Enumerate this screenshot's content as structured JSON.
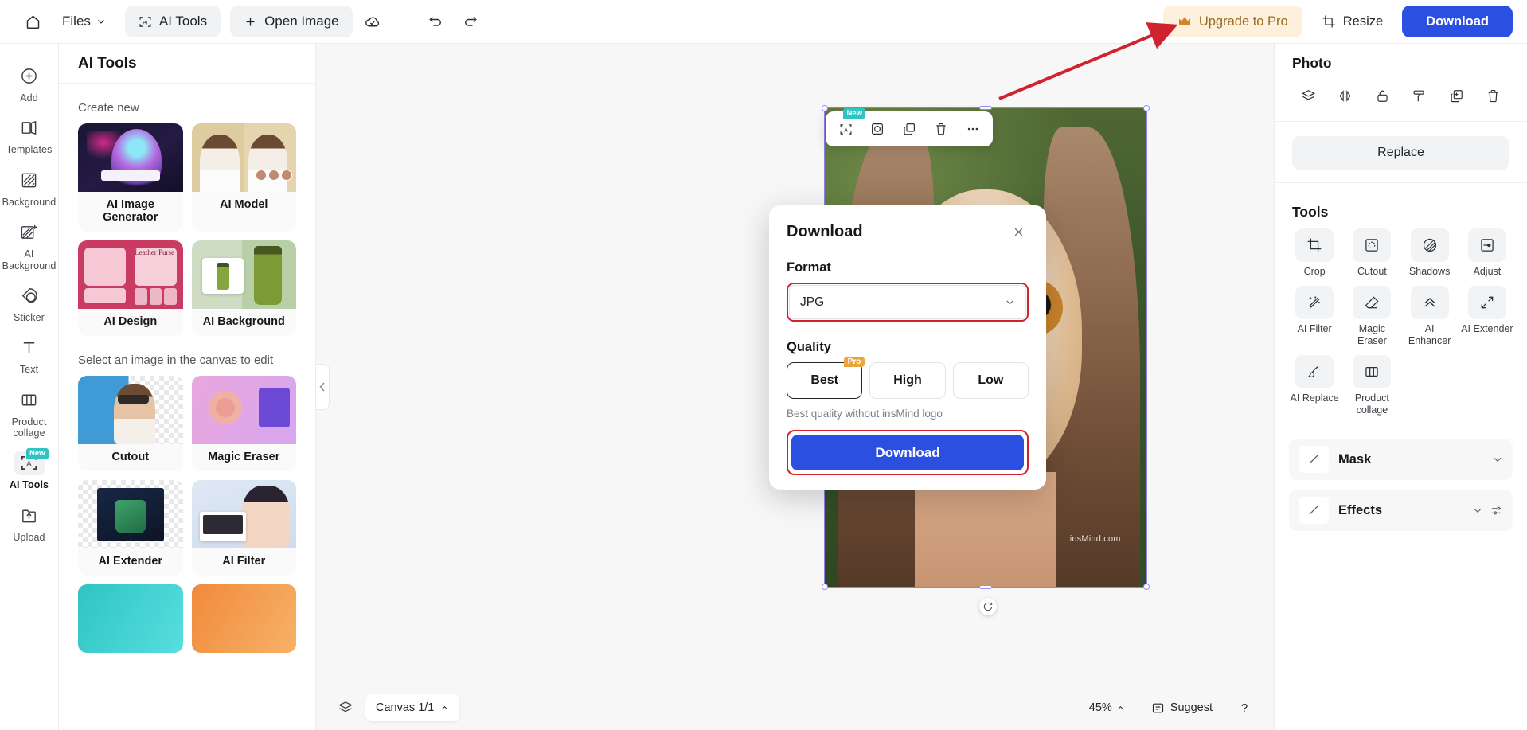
{
  "topbar": {
    "home_icon": "home-icon",
    "files_label": "Files",
    "ai_tools_label": "AI Tools",
    "open_image_label": "Open Image",
    "cloud_icon": "cloud-check-icon",
    "undo_icon": "undo-icon",
    "redo_icon": "redo-icon",
    "upgrade_label": "Upgrade to Pro",
    "crown_icon": "crown-icon",
    "resize_label": "Resize",
    "resize_icon": "crop-icon",
    "download_label": "Download",
    "accent_blue": "#2b4fe0",
    "upgrade_bg": "#fdf0dd",
    "upgrade_text": "#9a6a22"
  },
  "rail": {
    "items": [
      {
        "label": "Add",
        "icon": "plus-circle-icon",
        "active": false
      },
      {
        "label": "Templates",
        "icon": "templates-icon",
        "active": false
      },
      {
        "label": "Background",
        "icon": "background-icon",
        "active": false
      },
      {
        "label": "AI Background",
        "icon": "ai-background-icon",
        "active": false
      },
      {
        "label": "Sticker",
        "icon": "sticker-icon",
        "active": false
      },
      {
        "label": "Text",
        "icon": "text-icon",
        "active": false
      },
      {
        "label": "Product collage",
        "icon": "product-collage-icon",
        "active": false
      },
      {
        "label": "AI Tools",
        "icon": "ai-tools-icon",
        "active": true,
        "badge": "New"
      },
      {
        "label": "Upload",
        "icon": "upload-icon",
        "active": false
      }
    ]
  },
  "panel": {
    "title": "AI Tools",
    "create_new_label": "Create new",
    "create_cards": [
      {
        "label": "AI Image Generator",
        "art": "t-gen"
      },
      {
        "label": "AI Model",
        "art": "t-model"
      },
      {
        "label": "AI Design",
        "art": "t-design"
      },
      {
        "label": "AI Background",
        "art": "t-bg"
      }
    ],
    "select_hint": "Select an image in the canvas to edit",
    "edit_cards": [
      {
        "label": "Cutout",
        "art": "t-cut"
      },
      {
        "label": "Magic Eraser",
        "art": "t-mag"
      },
      {
        "label": "AI Extender",
        "art": "t-ext"
      },
      {
        "label": "AI Filter",
        "art": "t-fil"
      }
    ]
  },
  "canvas": {
    "watermark": "insMind.com",
    "selection_toolbar": [
      {
        "icon": "ai-tools-icon",
        "badge": "New",
        "name": "ai-tools"
      },
      {
        "icon": "mask-icon",
        "name": "mask"
      },
      {
        "icon": "duplicate-icon",
        "name": "duplicate"
      },
      {
        "icon": "trash-icon",
        "name": "delete"
      },
      {
        "icon": "more-icon",
        "name": "more"
      }
    ],
    "rotate_icon": "rotate-icon"
  },
  "bottombar": {
    "layers_icon": "layers-icon",
    "canvas_label": "Canvas 1/1",
    "zoom_label": "45%",
    "suggest_label": "Suggest",
    "suggest_icon": "suggest-icon",
    "help_label": "?"
  },
  "right": {
    "photo_title": "Photo",
    "photo_actions": [
      {
        "icon": "layers-icon",
        "name": "arrange"
      },
      {
        "icon": "flip-icon",
        "name": "flip"
      },
      {
        "icon": "lock-icon",
        "name": "lock"
      },
      {
        "icon": "paint-roller-icon",
        "name": "style"
      },
      {
        "icon": "duplicate-icon",
        "name": "duplicate"
      },
      {
        "icon": "trash-icon",
        "name": "delete"
      }
    ],
    "replace_label": "Replace",
    "tools_title": "Tools",
    "tools": [
      {
        "label": "Crop",
        "icon": "crop-icon"
      },
      {
        "label": "Cutout",
        "icon": "cutout-icon"
      },
      {
        "label": "Shadows",
        "icon": "shadows-icon"
      },
      {
        "label": "Adjust",
        "icon": "adjust-icon"
      },
      {
        "label": "AI Filter",
        "icon": "magic-wand-icon"
      },
      {
        "label": "Magic Eraser",
        "icon": "eraser-icon"
      },
      {
        "label": "AI Enhancer",
        "icon": "chevrons-up-icon"
      },
      {
        "label": "AI Extender",
        "icon": "expand-icon"
      },
      {
        "label": "AI Replace",
        "icon": "brush-icon"
      },
      {
        "label": "Product collage",
        "icon": "product-collage-icon"
      }
    ],
    "accordions": [
      {
        "label": "Mask",
        "icon": "mask-swatch-icon",
        "chevron": "chevron-down-icon",
        "extra": null
      },
      {
        "label": "Effects",
        "icon": "effects-swatch-icon",
        "chevron": "chevron-down-icon",
        "extra": "sliders-icon"
      }
    ]
  },
  "modal": {
    "title": "Download",
    "close_icon": "close-icon",
    "format_label": "Format",
    "format_value": "JPG",
    "format_chevron": "chevron-down-icon",
    "quality_label": "Quality",
    "quality_options": [
      {
        "label": "Best",
        "selected": true,
        "badge": "Pro"
      },
      {
        "label": "High",
        "selected": false,
        "badge": null
      },
      {
        "label": "Low",
        "selected": false,
        "badge": null
      }
    ],
    "quality_note": "Best quality without insMind logo",
    "download_label": "Download",
    "highlight_color": "#cf2330"
  }
}
